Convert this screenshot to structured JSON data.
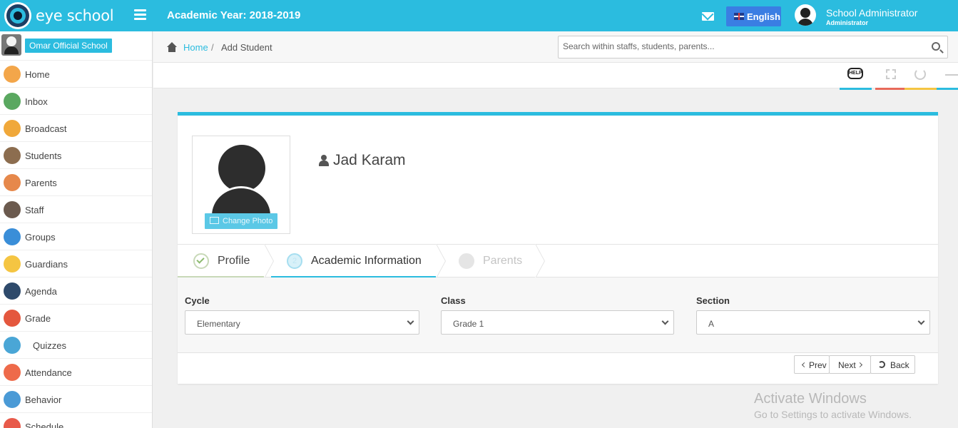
{
  "header": {
    "brand": "eye school",
    "academic_year": "Academic Year: 2018-2019",
    "language": "English",
    "user_name": "School Administrator",
    "user_role": "Administrator"
  },
  "sidebar": {
    "school_name": "Omar Official School",
    "items": [
      {
        "label": "Home",
        "icon": "home-icon",
        "color": "#f3a64a"
      },
      {
        "label": "Inbox",
        "icon": "inbox-icon",
        "color": "#5aa860"
      },
      {
        "label": "Broadcast",
        "icon": "broadcast-icon",
        "color": "#f0a83a"
      },
      {
        "label": "Students",
        "icon": "students-icon",
        "color": "#8c6d4f"
      },
      {
        "label": "Parents",
        "icon": "parents-icon",
        "color": "#e6884b"
      },
      {
        "label": "Staff",
        "icon": "staff-icon",
        "color": "#6b5a4e"
      },
      {
        "label": "Groups",
        "icon": "groups-icon",
        "color": "#3a8ed8"
      },
      {
        "label": "Guardians",
        "icon": "guardians-icon",
        "color": "#f5c542"
      },
      {
        "label": "Agenda",
        "icon": "agenda-icon",
        "color": "#2e4a6b"
      },
      {
        "label": "Grade",
        "icon": "grade-icon",
        "color": "#e4573e"
      },
      {
        "label": "Quizzes",
        "icon": "quizzes-icon",
        "color": "#4aa6d6"
      },
      {
        "label": "Attendance",
        "icon": "attendance-icon",
        "color": "#ee6a4a"
      },
      {
        "label": "Behavior",
        "icon": "behavior-icon",
        "color": "#4a9ad6"
      },
      {
        "label": "Schedule",
        "icon": "schedule-icon",
        "color": "#e85a4a"
      }
    ]
  },
  "breadcrumb": {
    "home": "Home",
    "separator": "/",
    "current": "Add Student"
  },
  "search": {
    "placeholder": "Search within staffs, students, parents..."
  },
  "toolbar": {
    "help_label": "HELP",
    "colors": [
      "#2bbcdf",
      "#e86a5a",
      "#f5c542",
      "#2bbcdf"
    ]
  },
  "student": {
    "name": "Jad Karam",
    "change_photo": "Change Photo"
  },
  "steps": [
    {
      "number": "1",
      "label": "Profile",
      "state": "done"
    },
    {
      "number": "2",
      "label": "Academic Information",
      "state": "active"
    },
    {
      "number": "3",
      "label": "Parents",
      "state": "pending"
    }
  ],
  "form": {
    "cycle": {
      "label": "Cycle",
      "value": "Elementary"
    },
    "class": {
      "label": "Class",
      "value": "Grade 1"
    },
    "section": {
      "label": "Section",
      "value": "A"
    }
  },
  "buttons": {
    "prev": "Prev",
    "next": "Next",
    "back": "Back"
  },
  "watermark": {
    "line1": "Activate Windows",
    "line2": "Go to Settings to activate Windows."
  }
}
